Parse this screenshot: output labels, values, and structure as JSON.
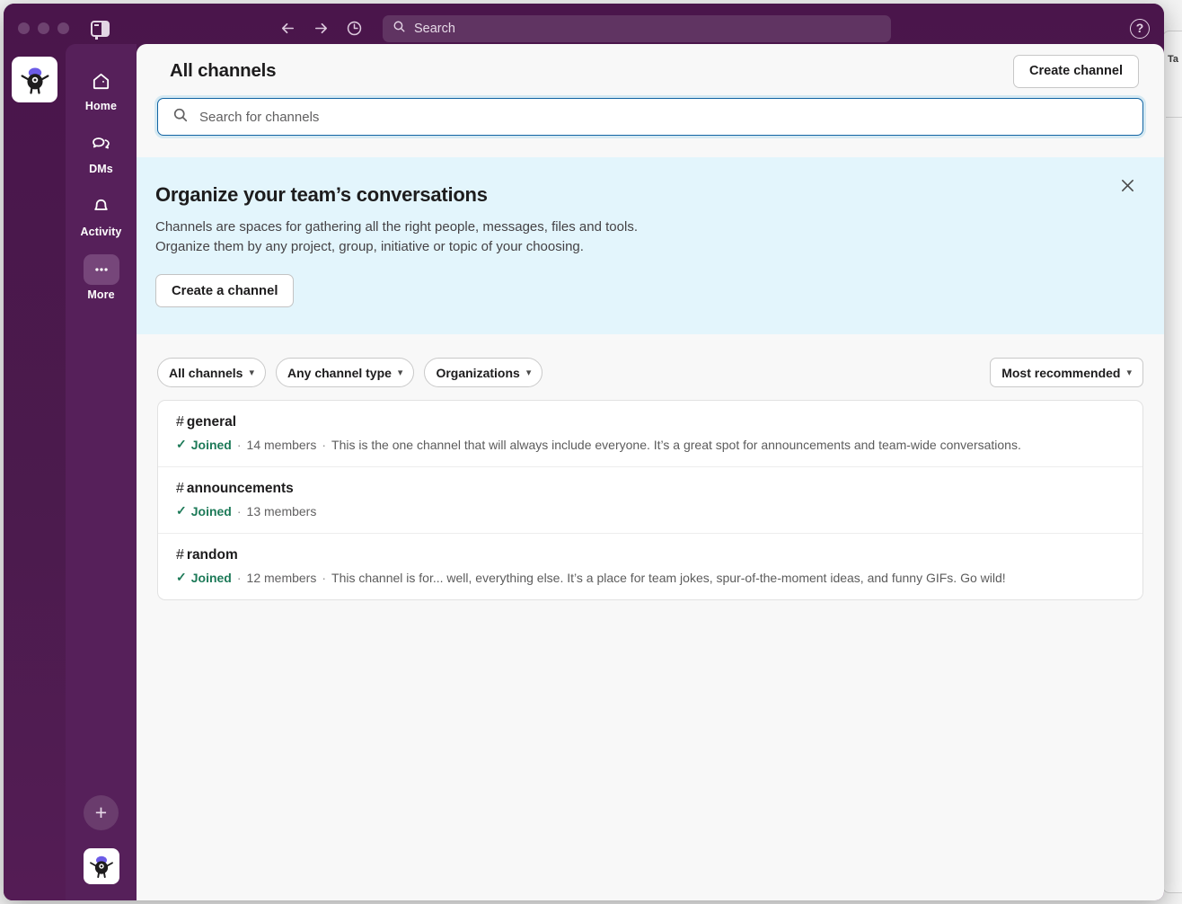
{
  "titlebar": {
    "panel_toggle_name": "sidebar-panel-toggle",
    "back_label": "Back",
    "forward_label": "Forward",
    "history_label": "History",
    "search_placeholder": "Search",
    "help_label": "?"
  },
  "rail": {
    "workspace_name": "Workspace",
    "items": [
      {
        "label": "Home",
        "icon": "home-icon",
        "active": false
      },
      {
        "label": "DMs",
        "icon": "dms-icon",
        "active": false
      },
      {
        "label": "Activity",
        "icon": "bell-icon",
        "active": false
      },
      {
        "label": "More",
        "icon": "ellipsis-icon",
        "active": true
      }
    ],
    "new_label": "+",
    "profile_label": "You"
  },
  "header": {
    "title": "All channels",
    "create_channel_label": "Create channel"
  },
  "search": {
    "placeholder": "Search for channels",
    "value": ""
  },
  "banner": {
    "heading": "Organize your team’s conversations",
    "line1": "Channels are spaces for gathering all the right people, messages, files and tools.",
    "line2": "Organize them by any project, group, initiative or topic of your choosing.",
    "button_label": "Create a channel",
    "close_label": "×",
    "bg_color": "#e3f5fc"
  },
  "filters": [
    {
      "label": "All channels",
      "name": "filter-all-channels"
    },
    {
      "label": "Any channel type",
      "name": "filter-channel-type"
    },
    {
      "label": "Organizations",
      "name": "filter-organizations"
    }
  ],
  "sort": {
    "label": "Most recommended"
  },
  "channels": [
    {
      "hash": "#",
      "name": "general",
      "status": "Joined",
      "members": "14 members",
      "description": "This is the one channel that will always include everyone. It’s a great spot for announcements and team-wide conversations."
    },
    {
      "hash": "#",
      "name": "announcements",
      "status": "Joined",
      "members": "13 members",
      "description": ""
    },
    {
      "hash": "#",
      "name": "random",
      "status": "Joined",
      "members": "12 members",
      "description": "This channel is for... well, everything else. It’s a place for team jokes, spur-of-the-moment ideas, and funny GIFs. Go wild!"
    }
  ],
  "colors": {
    "chrome_purple": "#4a154b",
    "nav_purple": "#56205a",
    "banner_blue": "#e3f5fc",
    "joined_green": "#1d7a58",
    "focus_blue": "#1264a3"
  },
  "separator": "·",
  "check": "✓"
}
